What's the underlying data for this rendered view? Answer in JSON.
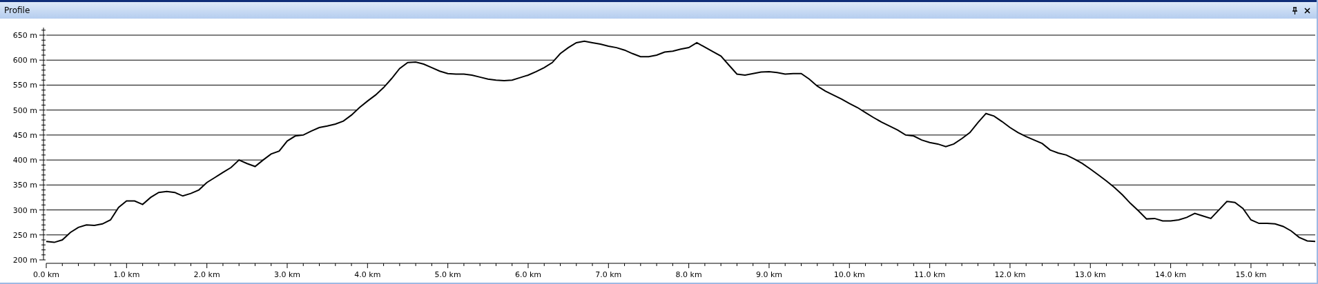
{
  "window": {
    "title": "Profile"
  },
  "chart_data": {
    "type": "area",
    "x": [
      0,
      0.1,
      0.2,
      0.3,
      0.4,
      0.5,
      0.6,
      0.7,
      0.8,
      0.9,
      1,
      1.1,
      1.2,
      1.3,
      1.4,
      1.5,
      1.6,
      1.7,
      1.8,
      1.9,
      2,
      2.1,
      2.2,
      2.3,
      2.4,
      2.5,
      2.6,
      2.7,
      2.8,
      2.9,
      3,
      3.1,
      3.2,
      3.3,
      3.4,
      3.5,
      3.6,
      3.7,
      3.8,
      3.9,
      4,
      4.1,
      4.2,
      4.3,
      4.4,
      4.5,
      4.6,
      4.7,
      4.8,
      4.9,
      5,
      5.1,
      5.2,
      5.3,
      5.4,
      5.5,
      5.6,
      5.7,
      5.8,
      5.9,
      6,
      6.1,
      6.2,
      6.3,
      6.4,
      6.5,
      6.6,
      6.7,
      6.8,
      6.9,
      7,
      7.1,
      7.2,
      7.3,
      7.4,
      7.5,
      7.6,
      7.7,
      7.8,
      7.9,
      8,
      8.1,
      8.2,
      8.3,
      8.4,
      8.5,
      8.6,
      8.7,
      8.8,
      8.9,
      9,
      9.1,
      9.2,
      9.3,
      9.4,
      9.5,
      9.6,
      9.7,
      9.8,
      9.9,
      10,
      10.1,
      10.2,
      10.3,
      10.4,
      10.5,
      10.6,
      10.7,
      10.8,
      10.9,
      11,
      11.1,
      11.2,
      11.3,
      11.4,
      11.5,
      11.6,
      11.7,
      11.8,
      11.9,
      12,
      12.1,
      12.2,
      12.3,
      12.4,
      12.5,
      12.6,
      12.7,
      12.8,
      12.9,
      13,
      13.1,
      13.2,
      13.3,
      13.4,
      13.5,
      13.6,
      13.7,
      13.8,
      13.9,
      14,
      14.1,
      14.2,
      14.3,
      14.4,
      14.5,
      14.6,
      14.7,
      14.8,
      14.9,
      15,
      15.1,
      15.2,
      15.3,
      15.4,
      15.5,
      15.6,
      15.7,
      15.8
    ],
    "grid": true,
    "values": [
      237,
      235,
      240,
      255,
      265,
      270,
      269,
      272,
      280,
      305,
      318,
      318,
      311,
      325,
      335,
      337,
      335,
      328,
      333,
      340,
      355,
      365,
      375,
      385,
      400,
      393,
      387,
      400,
      412,
      418,
      438,
      448,
      450,
      458,
      465,
      468,
      472,
      478,
      490,
      505,
      518,
      530,
      545,
      563,
      583,
      595,
      596,
      592,
      585,
      578,
      573,
      572,
      572,
      570,
      566,
      562,
      560,
      559,
      560,
      565,
      570,
      577,
      585,
      595,
      613,
      625,
      635,
      638,
      635,
      632,
      628,
      625,
      620,
      613,
      607,
      607,
      610,
      616,
      618,
      622,
      625,
      635,
      626,
      617,
      608,
      590,
      572,
      570,
      573,
      576,
      577,
      575,
      572,
      573,
      573,
      562,
      548,
      538,
      530,
      522,
      513,
      505,
      495,
      485,
      476,
      468,
      460,
      450,
      448,
      440,
      435,
      432,
      427,
      432,
      443,
      455,
      475,
      493,
      488,
      477,
      465,
      455,
      447,
      440,
      433,
      420,
      414,
      410,
      402,
      393,
      382,
      370,
      358,
      345,
      330,
      313,
      298,
      282,
      283,
      278,
      278,
      280,
      285,
      293,
      288,
      283,
      300,
      317,
      315,
      303,
      280,
      273,
      273,
      272,
      267,
      258,
      245,
      238,
      237
    ],
    "xlim": [
      0,
      15.8
    ],
    "ylim": [
      200,
      665
    ],
    "xticks": [
      {
        "value": 0,
        "label": "0.0 km"
      },
      {
        "value": 1,
        "label": "1.0 km"
      },
      {
        "value": 2,
        "label": "2.0 km"
      },
      {
        "value": 3,
        "label": "3.0 km"
      },
      {
        "value": 4,
        "label": "4.0 km"
      },
      {
        "value": 5,
        "label": "5.0 km"
      },
      {
        "value": 6,
        "label": "6.0 km"
      },
      {
        "value": 7,
        "label": "7.0 km"
      },
      {
        "value": 8,
        "label": "8.0 km"
      },
      {
        "value": 9,
        "label": "9.0 km"
      },
      {
        "value": 10,
        "label": "10.0 km"
      },
      {
        "value": 11,
        "label": "11.0 km"
      },
      {
        "value": 12,
        "label": "12.0 km"
      },
      {
        "value": 13,
        "label": "13.0 km"
      },
      {
        "value": 14,
        "label": "14.0 km"
      },
      {
        "value": 15,
        "label": "15.0 km"
      }
    ],
    "yticks": [
      {
        "value": 200,
        "label": "200 m"
      },
      {
        "value": 250,
        "label": "250 m"
      },
      {
        "value": 300,
        "label": "300 m"
      },
      {
        "value": 350,
        "label": "350 m"
      },
      {
        "value": 400,
        "label": "400 m"
      },
      {
        "value": 450,
        "label": "450 m"
      },
      {
        "value": 500,
        "label": "500 m"
      },
      {
        "value": 550,
        "label": "550 m"
      },
      {
        "value": 600,
        "label": "600 m"
      },
      {
        "value": 650,
        "label": "650 m"
      }
    ]
  }
}
